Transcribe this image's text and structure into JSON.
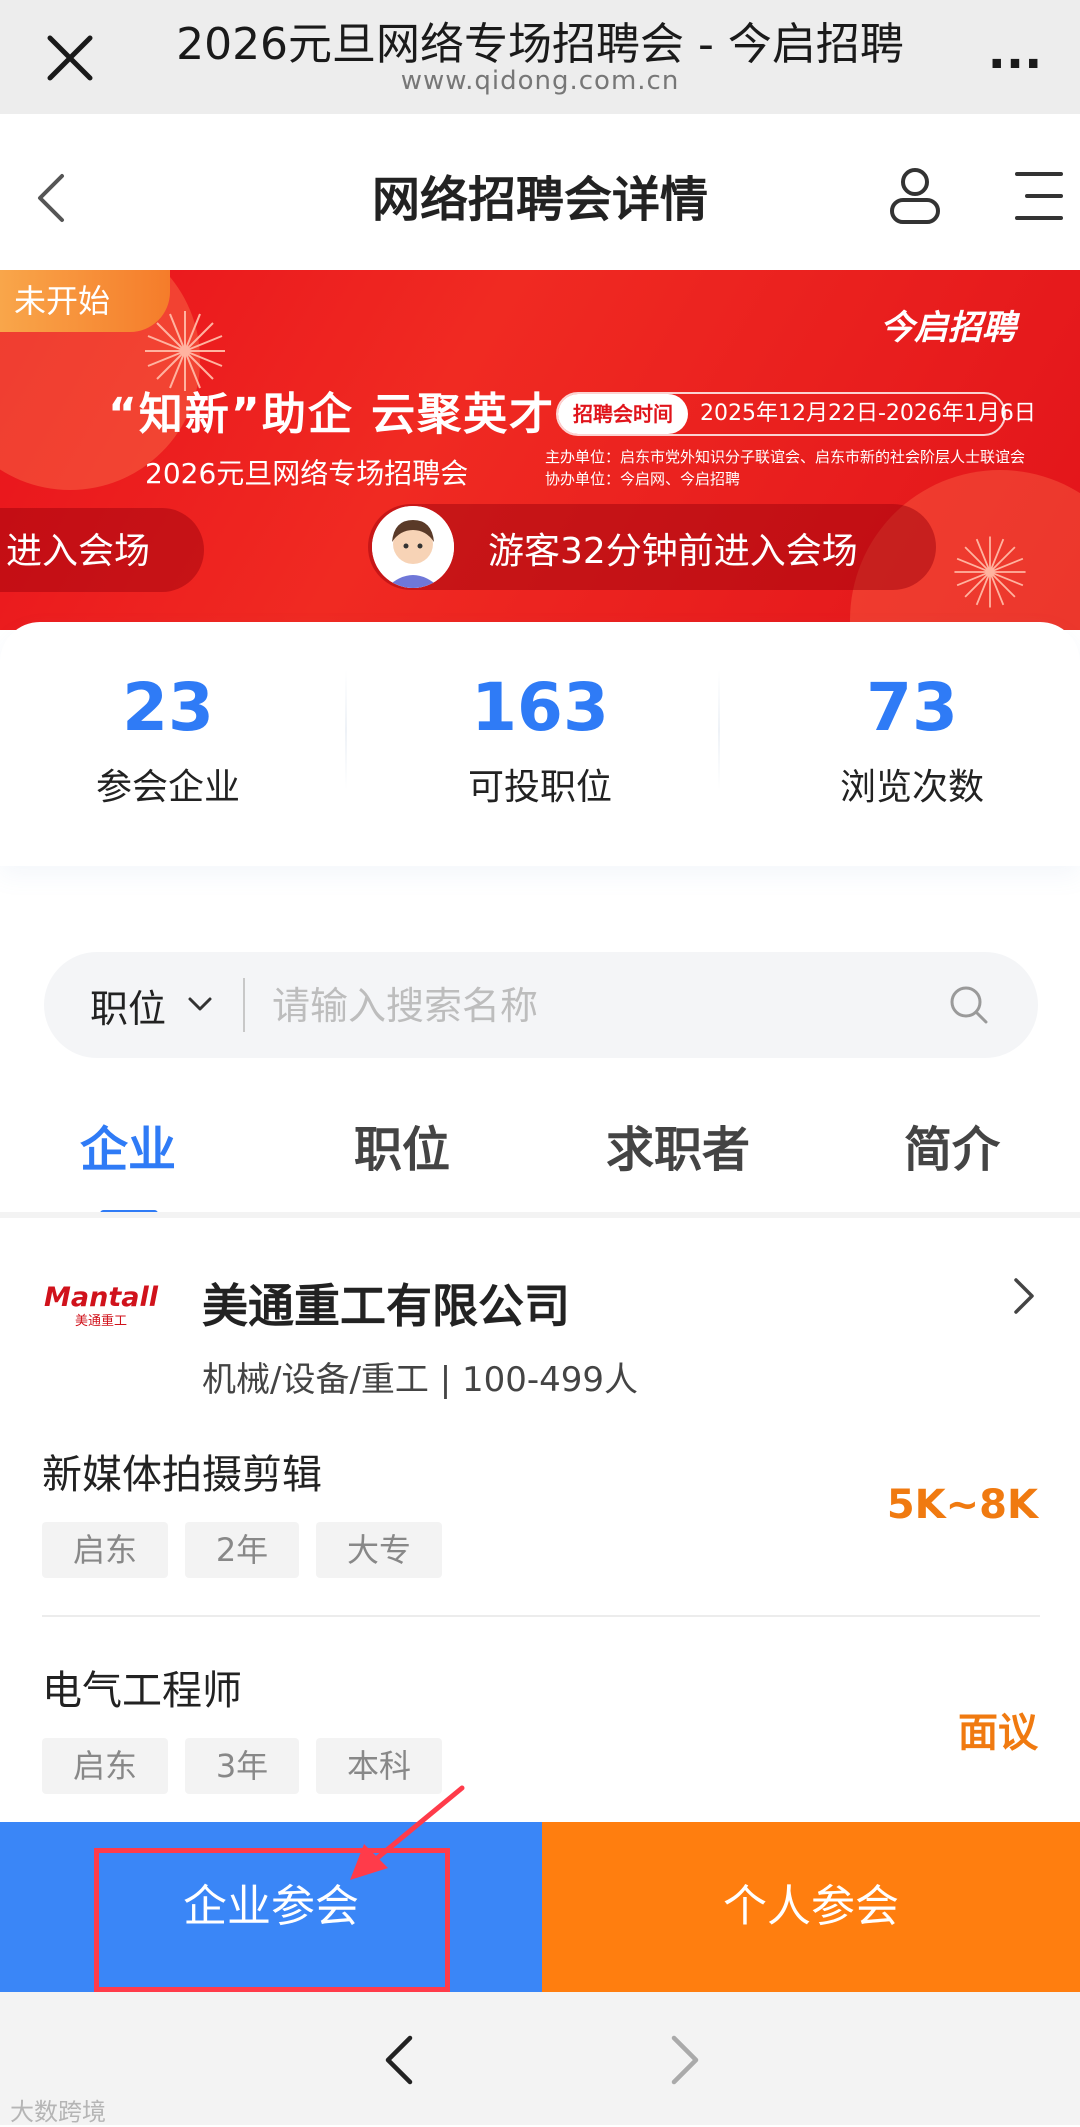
{
  "browser": {
    "title": "2026元旦网络专场招聘会 - 今启招聘",
    "url": "www.qidong.com.cn",
    "more": "..."
  },
  "header": {
    "title": "网络招聘会详情"
  },
  "banner": {
    "status_tag": "未开始",
    "brand": "今启招聘",
    "slogan": "“知新”助企  云聚英才",
    "subtitle": "2026元旦网络专场招聘会",
    "time_label": "招聘会时间",
    "time_value": "2025年12月22日-2026年1月6日",
    "organizer": "主办单位：启东市党外知识分子联谊会、启东市新的社会阶层人士联谊会",
    "co_organizer": "协办单位：今启网、今启招聘",
    "marquee_left": "进入会场",
    "marquee_text": "游客32分钟前进入会场"
  },
  "stats": [
    {
      "value": "23",
      "label": "参会企业"
    },
    {
      "value": "163",
      "label": "可投职位"
    },
    {
      "value": "73",
      "label": "浏览次数"
    }
  ],
  "search": {
    "type": "职位",
    "placeholder": "请输入搜索名称"
  },
  "tabs": [
    {
      "label": "企业",
      "active": true
    },
    {
      "label": "职位",
      "active": false
    },
    {
      "label": "求职者",
      "active": false
    },
    {
      "label": "简介",
      "active": false
    }
  ],
  "company": {
    "logo_text": "Mantall",
    "logo_sub": "美通重工",
    "name": "美通重工有限公司",
    "meta": "机械/设备/重工  |  100-499人",
    "jobs": [
      {
        "title": "新媒体拍摄剪辑",
        "salary": "5K~8K",
        "tags": [
          "启东",
          "2年",
          "大专"
        ]
      },
      {
        "title": "电气工程师",
        "salary": "面议",
        "tags": [
          "启东",
          "3年",
          "本科"
        ]
      }
    ]
  },
  "actions": {
    "company_join": "企业参会",
    "person_join": "个人参会"
  },
  "watermark": "大数跨境",
  "colors": {
    "primary_blue": "#2f7bf6",
    "orange": "#ff7e0f",
    "banner_red": "#e8121b",
    "highlight_red": "#ff3b4a"
  }
}
